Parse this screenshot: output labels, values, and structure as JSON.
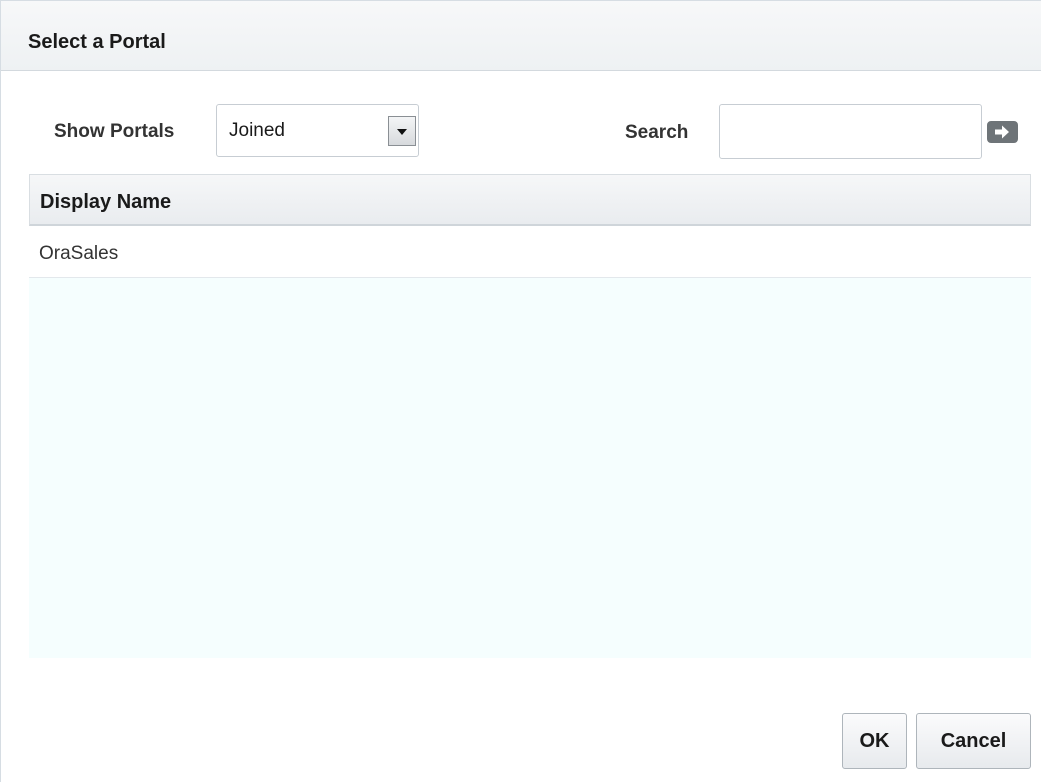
{
  "dialog": {
    "title": "Select a Portal"
  },
  "filter": {
    "show_portals_label": "Show Portals",
    "show_portals_value": "Joined",
    "search_label": "Search",
    "search_value": "",
    "go_icon": "arrow-right-icon"
  },
  "table": {
    "columns": [
      "Display Name"
    ],
    "rows": [
      {
        "display_name": "OraSales"
      }
    ]
  },
  "buttons": {
    "ok_label": "OK",
    "cancel_label": "Cancel"
  }
}
